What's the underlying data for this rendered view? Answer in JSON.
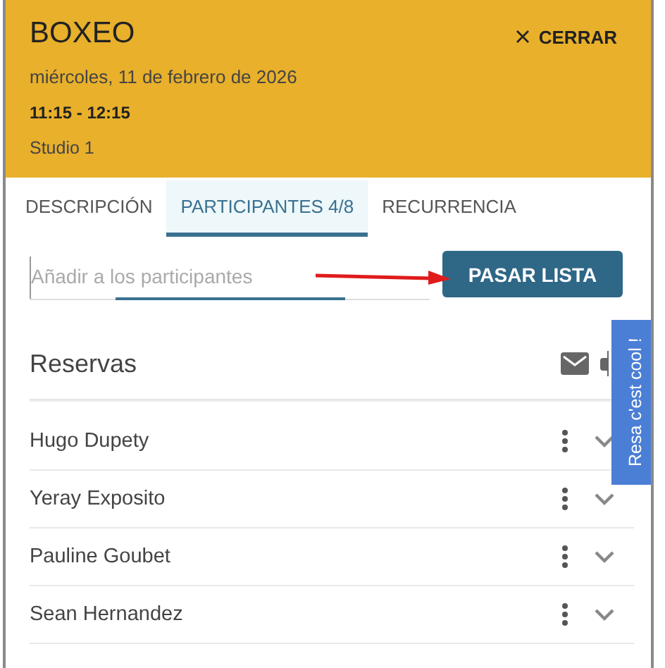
{
  "header": {
    "title": "BOXEO",
    "close_label": "CERRAR",
    "date": "miércoles, 11 de febrero de 2026",
    "time": "11:15 - 12:15",
    "location": "Studio 1"
  },
  "tabs": [
    {
      "label": "DESCRIPCIÓN",
      "selected": false
    },
    {
      "label": "PARTICIPANTES 4/8",
      "selected": true
    },
    {
      "label": "RECURRENCIA",
      "selected": false
    }
  ],
  "search": {
    "placeholder": "Añadir a los participantes"
  },
  "roll_call_button": "PASAR LISTA",
  "reservations": {
    "title": "Reservas",
    "rows": [
      {
        "name": "Hugo Dupety"
      },
      {
        "name": "Yeray Exposito"
      },
      {
        "name": "Pauline Goubet"
      },
      {
        "name": "Sean Hernandez"
      }
    ]
  },
  "feedback_tab": "Resa c'est cool !"
}
